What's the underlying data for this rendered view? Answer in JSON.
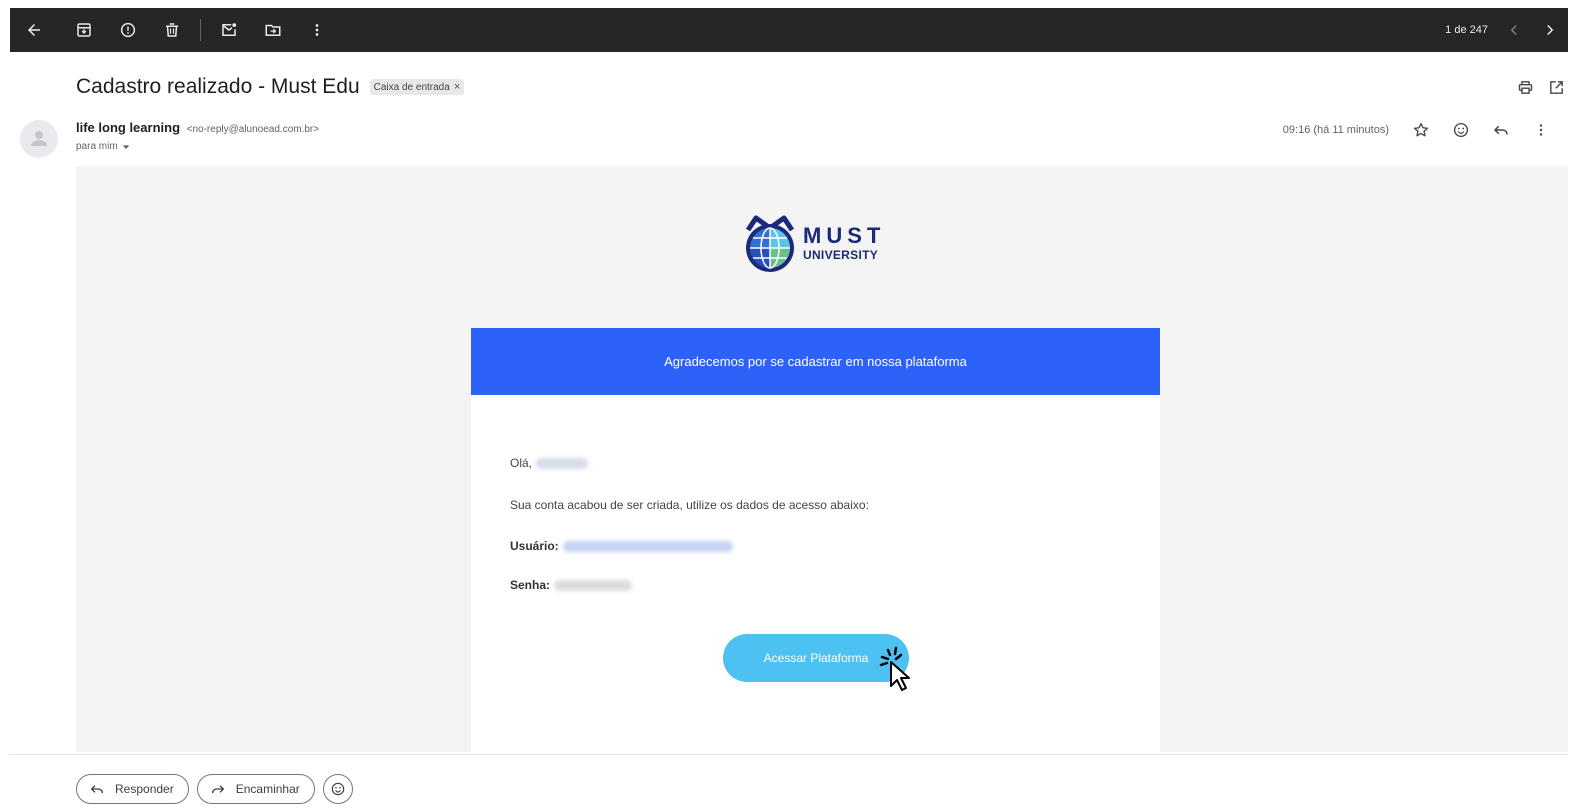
{
  "toolbar": {
    "icons": [
      "back-arrow-icon",
      "archive-icon",
      "report-spam-icon",
      "delete-icon",
      "mark-unread-icon",
      "move-to-icon",
      "more-vert-icon"
    ],
    "count": "1 de 247"
  },
  "email": {
    "subject": "Cadastro realizado - Must Edu",
    "label": "Caixa de entrada",
    "label_close": "×",
    "sender_name": "life long learning",
    "sender_email": "<no-reply@alunoead.com.br>",
    "to": "para mim",
    "timestamp": "09:16 (há 11 minutos)"
  },
  "body": {
    "logo_top": "MUST",
    "logo_bottom": "UNIVERSITY",
    "banner": "Agradecemos por se cadastrar em nossa plataforma",
    "greeting": "Olá,",
    "info": "Sua conta acabou de ser criada, utilize os dados de acesso abaixo:",
    "user_label": "Usuário:",
    "pass_label": "Senha:",
    "cta": "Acessar Plataforma"
  },
  "actions": {
    "reply": "Responder",
    "forward": "Encaminhar"
  },
  "colors": {
    "toolbar_bg": "#262626",
    "banner": "#2d62f8",
    "cta": "#4cc1f2",
    "email_bg": "#f4f4f4",
    "logo_navy": "#1b2a78"
  }
}
